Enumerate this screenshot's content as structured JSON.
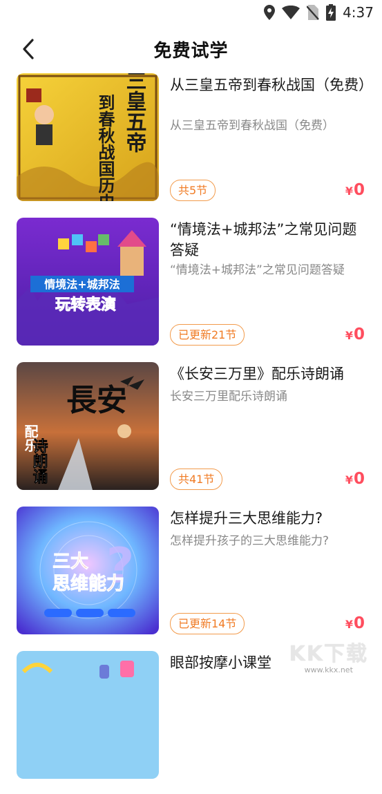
{
  "status_bar": {
    "time": "4:37",
    "icons": [
      "location-icon",
      "wifi-icon",
      "no-sim-icon",
      "battery-charging-icon"
    ]
  },
  "header": {
    "title": "免费试学",
    "back_icon": "chevron-left-icon"
  },
  "courses": [
    {
      "title": "从三皇五帝到春秋战国（免费）",
      "subtitle": "从三皇五帝到春秋战国（免费）",
      "badge": "共5节",
      "price_symbol": "¥",
      "price": "0",
      "thumb": {
        "big_text_right": "从三皇五帝",
        "big_text_left": "到春秋战国历史剧"
      }
    },
    {
      "title": "“情境法+城邦法”之常见问题答疑",
      "subtitle": "“情境法+城邦法”之常见问题答疑",
      "badge": "已更新21节",
      "price_symbol": "¥",
      "price": "0",
      "thumb": {
        "banner": "情境法+城邦法",
        "headline": "玩转表演"
      }
    },
    {
      "title": "《长安三万里》配乐诗朗诵",
      "subtitle": "长安三万里配乐诗朗诵",
      "badge": "共41节",
      "price_symbol": "¥",
      "price": "0",
      "thumb": {
        "calligraphy": "長安",
        "side": "配乐",
        "main": "诗朗诵"
      }
    },
    {
      "title": "怎样提升三大思维能力?",
      "subtitle": "怎样提升孩子的三大思维能力?",
      "badge": "已更新14节",
      "price_symbol": "¥",
      "price": "0",
      "thumb": {
        "line1": "三大",
        "line2": "思维能力"
      }
    },
    {
      "title": "眼部按摩小课堂",
      "subtitle": "",
      "badge": "",
      "price_symbol": "",
      "price": "",
      "thumb": {}
    }
  ],
  "watermark": {
    "logo": "KK下载",
    "url": "www.kkx.net"
  },
  "colors": {
    "price": "#ff4d5e",
    "badge": "#f07b24",
    "subtitle": "#888888"
  }
}
